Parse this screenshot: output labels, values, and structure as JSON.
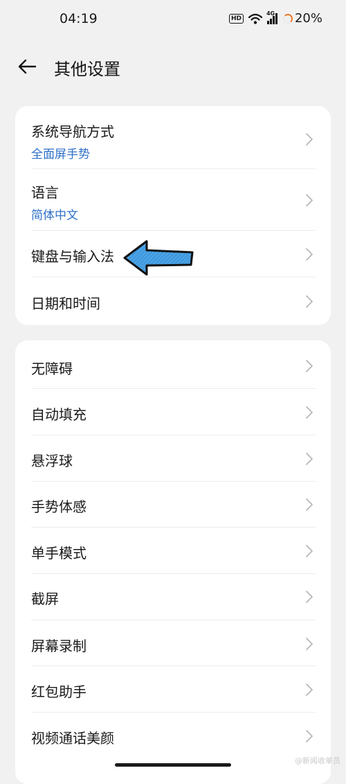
{
  "status_bar": {
    "time": "04:19",
    "hd_label": "HD",
    "network_label": "4G",
    "battery": "20%"
  },
  "header": {
    "title": "其他设置"
  },
  "group1": [
    {
      "label": "系统导航方式",
      "value": "全面屏手势"
    },
    {
      "label": "语言",
      "value": "简体中文"
    },
    {
      "label": "键盘与输入法"
    },
    {
      "label": "日期和时间"
    }
  ],
  "group2": [
    {
      "label": "无障碍"
    },
    {
      "label": "自动填充"
    },
    {
      "label": "悬浮球"
    },
    {
      "label": "手势体感"
    },
    {
      "label": "单手模式"
    },
    {
      "label": "截屏"
    },
    {
      "label": "屏幕录制"
    },
    {
      "label": "红包助手"
    },
    {
      "label": "视频通话美颜"
    }
  ],
  "watermark": "@新闻收单员",
  "colors": {
    "background": "#f1f1f1",
    "card": "#ffffff",
    "sub_value": "#2f70c8",
    "arrow_fill": "#4aa3e6",
    "battery_ring": "#f07a2a"
  }
}
